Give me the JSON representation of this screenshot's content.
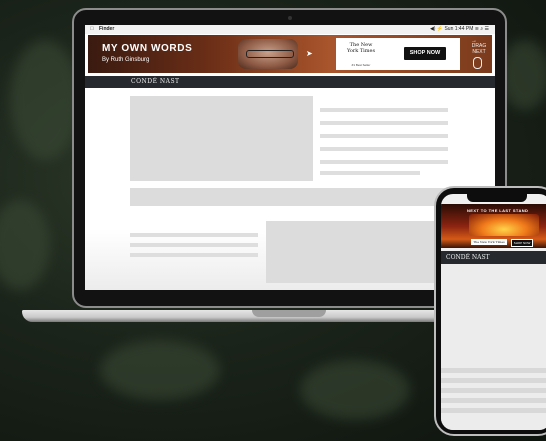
{
  "menubar": {
    "apple": "",
    "app": "Finder",
    "status": "◀)  ⚡  Sun 1:44 PM  ≋  ⌕  ☰"
  },
  "ad": {
    "title": "MY OWN WORDS",
    "subtitle": "By Ruth Ginsburg",
    "nyt_name": "The New York Times",
    "nyt_tag": "#1 Best Seller",
    "cta": "SHOP NOW",
    "drag_label_1": "DRAG",
    "drag_label_2": "NEXT"
  },
  "site": {
    "logo": "CONDÉ NAST"
  },
  "phone": {
    "ad_title": "NEXT TO THE LAST STAND",
    "ad_logo": "The New York Times",
    "ad_cta": "SHOP NOW",
    "logo": "CONDÉ NAST"
  },
  "colors": {
    "background": "#1b241a",
    "header_bar": "#262a2e",
    "placeholder": "#dcdcdc"
  }
}
